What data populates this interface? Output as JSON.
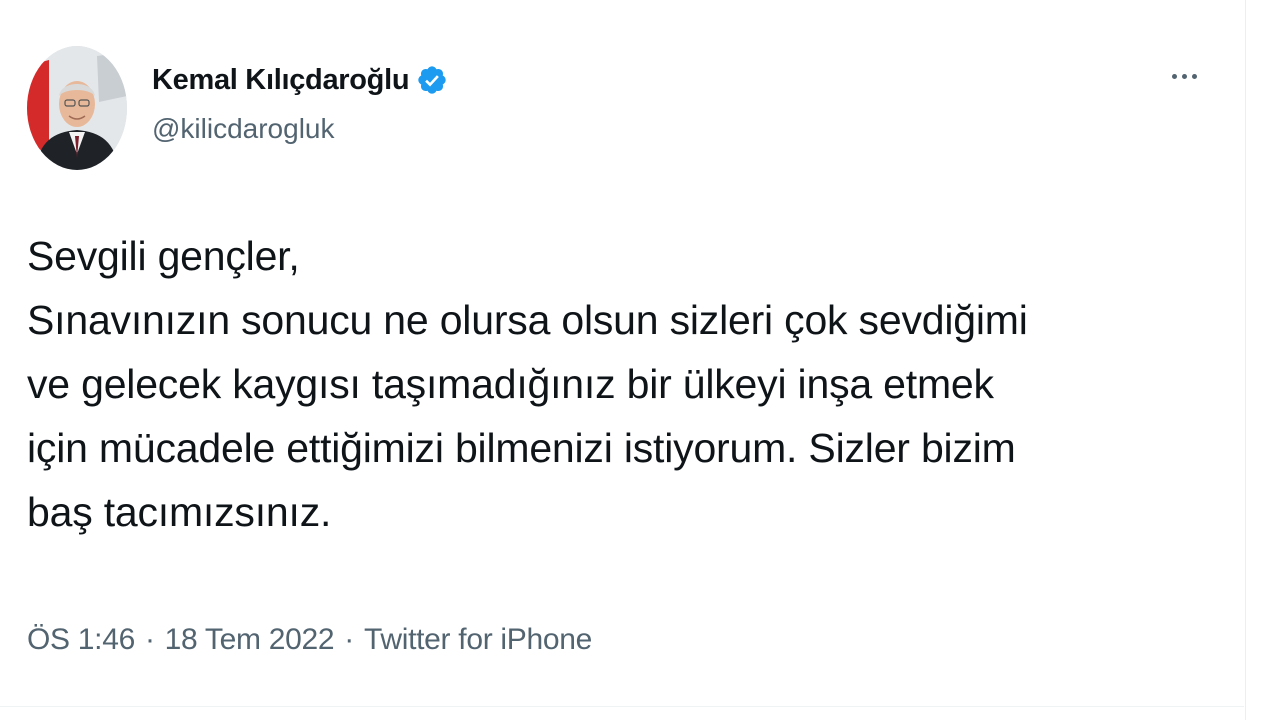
{
  "tweet": {
    "display_name": "Kemal Kılıçdaroğlu",
    "handle": "@kilicdarogluk",
    "text": "Sevgili gençler,\nSınavınızın sonucu ne olursa olsun sizleri çok sevdiğimi\nve gelecek kaygısı taşımadığınız bir ülkeyi inşa etmek\niçin mücadele ettiğimizi bilmenizi istiyorum. Sizler bizim\nbaş tacımızsınız.",
    "time": "ÖS 1:46",
    "date": "18 Tem 2022",
    "separator": "·",
    "source": "Twitter for iPhone"
  },
  "icons": {
    "verified": "verified-badge-icon",
    "more": "more-options-icon"
  },
  "colors": {
    "verified_blue": "#1d9bf0",
    "text_primary": "#0f1419",
    "text_secondary": "#536471"
  }
}
